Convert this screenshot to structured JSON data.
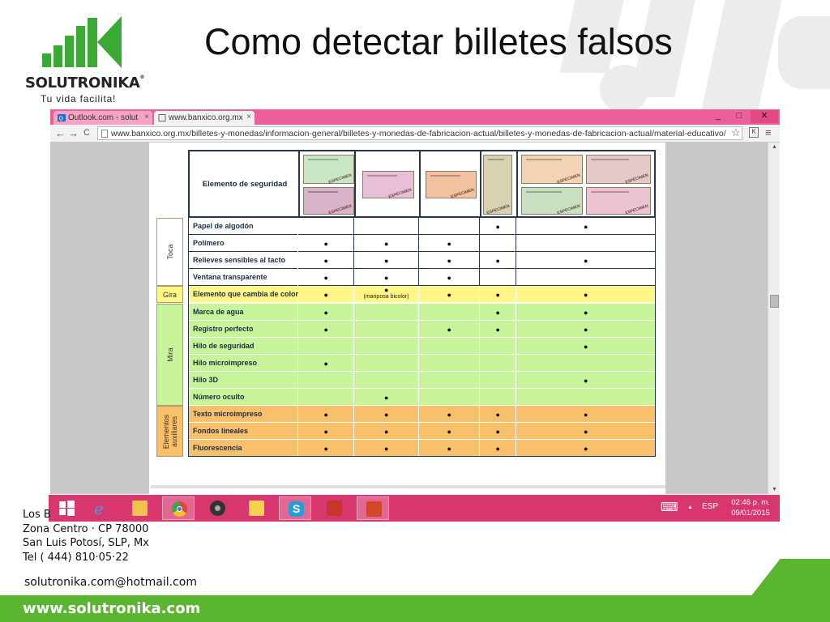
{
  "slide": {
    "title": "Como detectar billetes falsos",
    "logo": {
      "brand": "SOLUTRONIKA",
      "tagline": "Tu vida facilita!"
    },
    "contact": {
      "address_lines": [
        "Los B",
        "Zona Centro · CP 78000",
        "San Luis Potosí, SLP, Mx",
        "Tel ( 444) 810·05·22"
      ],
      "email": "solutronika.com@hotmail.com",
      "website": "www.solutronika.com"
    },
    "colors": {
      "brand_green": "#5ab630",
      "taskbar_pink": "#d8366f",
      "tab_pink": "#ec5f9b"
    }
  },
  "browser": {
    "tabs": [
      {
        "label": "Outlook.com - solut",
        "icon": "outlook-icon",
        "active": false
      },
      {
        "label": "www.banxico.org.mx",
        "icon": "page-icon",
        "active": true
      }
    ],
    "window_controls": {
      "minimize": "_",
      "maximize": "□",
      "close": "✕"
    },
    "nav": {
      "back": "←",
      "forward": "→",
      "reload": "C"
    },
    "url": "www.banxico.org.mx/billetes-y-monedas/informacion-general/billetes-y-monedas-de-fabricacion-actual/billetes-y-monedas-de-fabricacion-actual/material-educativo/",
    "star": "☆",
    "menu": "≡"
  },
  "table": {
    "header_label": "Elemento de seguridad",
    "specimen_text": "ESPECIMEN",
    "groups": [
      {
        "label": "Toca",
        "color": "#ffffff"
      },
      {
        "label": "Gira",
        "color": "#fff685"
      },
      {
        "label": "Mira",
        "color": "#c9f59a"
      },
      {
        "label": "Elementos auxiliares",
        "color": "#f8c06a"
      }
    ],
    "dot": "●",
    "rows": [
      {
        "feature": "Papel de algodón",
        "group": 0,
        "marks": [
          false,
          false,
          false,
          true,
          true
        ]
      },
      {
        "feature": "Polímero",
        "group": 0,
        "marks": [
          true,
          true,
          true,
          false,
          false
        ]
      },
      {
        "feature": "Relieves sensibles al tacto",
        "group": 0,
        "marks": [
          true,
          true,
          true,
          true,
          true
        ]
      },
      {
        "feature": "Ventana transparente",
        "group": 0,
        "marks": [
          true,
          true,
          true,
          false,
          false
        ]
      },
      {
        "feature": "Elemento que cambia de color",
        "group": 1,
        "marks": [
          true,
          true,
          true,
          true,
          true
        ],
        "note_col": 1,
        "note": "(mariposa bicolor)"
      },
      {
        "feature": "Marca de agua",
        "group": 2,
        "marks": [
          true,
          false,
          false,
          true,
          true
        ]
      },
      {
        "feature": "Registro perfecto",
        "group": 2,
        "marks": [
          true,
          false,
          true,
          true,
          true
        ]
      },
      {
        "feature": "Hilo de seguridad",
        "group": 2,
        "marks": [
          false,
          false,
          false,
          false,
          true
        ]
      },
      {
        "feature": "Hilo microimpreso",
        "group": 2,
        "marks": [
          true,
          false,
          false,
          false,
          false
        ]
      },
      {
        "feature": "Hilo 3D",
        "group": 2,
        "marks": [
          false,
          false,
          false,
          false,
          true
        ]
      },
      {
        "feature": "Número oculto",
        "group": 2,
        "marks": [
          false,
          true,
          false,
          false,
          false
        ]
      },
      {
        "feature": "Texto  microimpreso",
        "group": 3,
        "marks": [
          true,
          true,
          true,
          true,
          true
        ]
      },
      {
        "feature": "Fondos lineales",
        "group": 3,
        "marks": [
          true,
          true,
          true,
          true,
          true
        ]
      },
      {
        "feature": "Fluorescencia",
        "group": 3,
        "marks": [
          true,
          true,
          true,
          true,
          true
        ]
      }
    ]
  },
  "taskbar": {
    "apps": [
      {
        "name": "windows-start-icon"
      },
      {
        "name": "internet-explorer-icon"
      },
      {
        "name": "file-explorer-icon"
      },
      {
        "name": "chrome-icon",
        "active": true
      },
      {
        "name": "speaker-app-icon"
      },
      {
        "name": "sticky-notes-icon"
      },
      {
        "name": "skype-icon",
        "active": true
      },
      {
        "name": "office-app-icon"
      },
      {
        "name": "powerpoint-icon",
        "active": true
      }
    ],
    "tray": {
      "keyboard": "⌨",
      "arrow": "▲",
      "language": "ESP"
    },
    "clock": {
      "time": "02:46 p. m.",
      "date": "09/01/2015"
    }
  }
}
